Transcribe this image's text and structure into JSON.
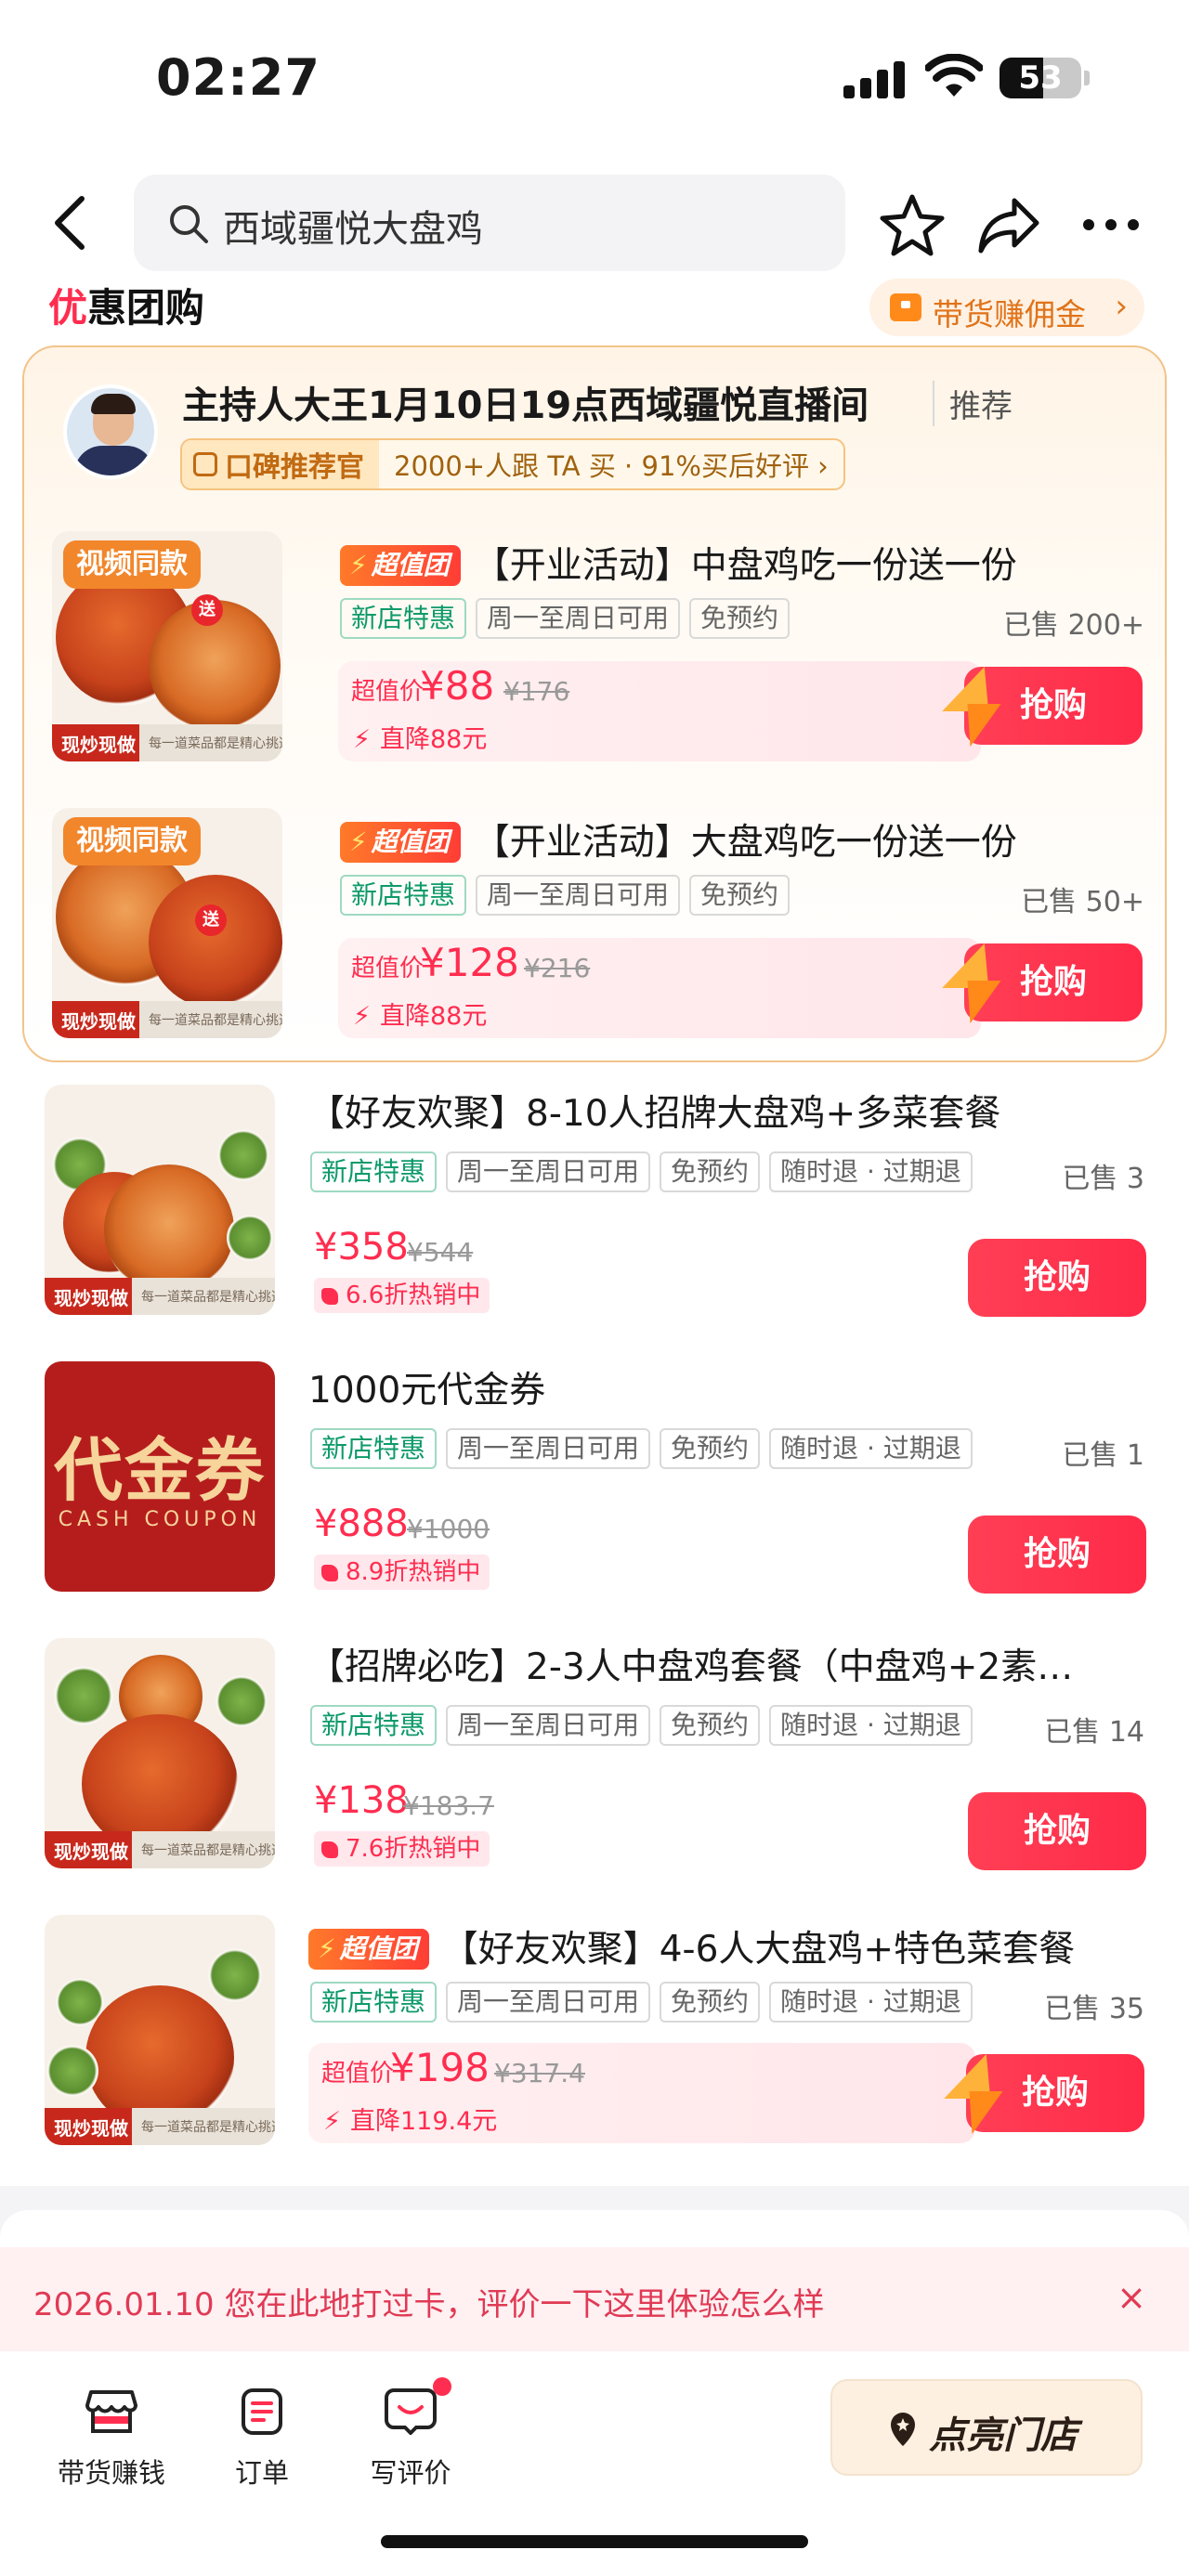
{
  "status_bar": {
    "time": "02:27",
    "battery": "53"
  },
  "nav": {
    "search_text": "西域疆悦大盘鸡"
  },
  "section": {
    "title_first": "优",
    "title_rest": "惠团购",
    "commission_label": "带货赚佣金",
    "commission_arrow": "›"
  },
  "host": {
    "title": "主持人大王1月10日19点西域疆悦直播间",
    "recommend": "推荐",
    "badge_label": "口碑推荐官",
    "badge_stats": "2000+人跟 TA 买 · 91%买后好评 ›"
  },
  "deals": [
    {
      "thumb_tag": "视频同款",
      "thumb_foot": "现炒现做",
      "thumb_sub": "每一道菜品都是精心挑选",
      "super_label": "超值团",
      "title": "【开业活动】中盘鸡吃一份送一份",
      "tags": [
        "新店特惠",
        "周一至周日可用",
        "免预约"
      ],
      "sold": "已售 200+",
      "price_label": "超值价",
      "price": "¥88",
      "original": "¥176",
      "discount": "直降88元",
      "buy": "抢购"
    },
    {
      "thumb_tag": "视频同款",
      "thumb_foot": "现炒现做",
      "thumb_sub": "每一道菜品都是精心挑选",
      "super_label": "超值团",
      "title": "【开业活动】大盘鸡吃一份送一份",
      "tags": [
        "新店特惠",
        "周一至周日可用",
        "免预约"
      ],
      "sold": "已售 50+",
      "price_label": "超值价",
      "price": "¥128",
      "original": "¥216",
      "discount": "直降88元",
      "buy": "抢购"
    },
    {
      "thumb_foot": "现炒现做",
      "thumb_sub": "每一道菜品都是精心挑选",
      "title": "【好友欢聚】8-10人招牌大盘鸡+多菜套餐",
      "tags": [
        "新店特惠",
        "周一至周日可用",
        "免预约",
        "随时退 · 过期退"
      ],
      "sold": "已售 3",
      "price": "¥358",
      "original": "¥544",
      "hot": "6.6折热销中",
      "buy": "抢购"
    },
    {
      "coupon_big": "代金券",
      "coupon_small": "CASH COUPON",
      "title": "1000元代金券",
      "tags": [
        "新店特惠",
        "周一至周日可用",
        "免预约",
        "随时退 · 过期退"
      ],
      "sold": "已售 1",
      "price": "¥888",
      "original": "¥1000",
      "hot": "8.9折热销中",
      "buy": "抢购"
    },
    {
      "thumb_foot": "现炒现做",
      "thumb_sub": "每一道菜品都是精心挑选",
      "title": "【招牌必吃】2-3人中盘鸡套餐（中盘鸡+2素…",
      "tags": [
        "新店特惠",
        "周一至周日可用",
        "免预约",
        "随时退 · 过期退"
      ],
      "sold": "已售 14",
      "price": "¥138",
      "original": "¥183.7",
      "hot": "7.6折热销中",
      "buy": "抢购"
    },
    {
      "thumb_foot": "现炒现做",
      "thumb_sub": "每一道菜品都是精心挑选",
      "super_label": "超值团",
      "title": "【好友欢聚】4-6人大盘鸡+特色菜套餐",
      "tags": [
        "新店特惠",
        "周一至周日可用",
        "免预约",
        "随时退 · 过期退"
      ],
      "sold": "已售 35",
      "price_label": "超值价",
      "price": "¥198",
      "original": "¥317.4",
      "discount": "直降119.4元",
      "buy": "抢购"
    }
  ],
  "checkin": {
    "text": "2026.01.10 您在此地打过卡，评价一下这里体验怎么样",
    "close": "×"
  },
  "bottom_bar": {
    "earn": "带货赚钱",
    "orders": "订单",
    "review": "写评价",
    "light_store": "点亮门店"
  },
  "colors": {
    "accent": "#ff2d4f",
    "green_tag": "#0d9a6a",
    "orange": "#f2862b"
  }
}
